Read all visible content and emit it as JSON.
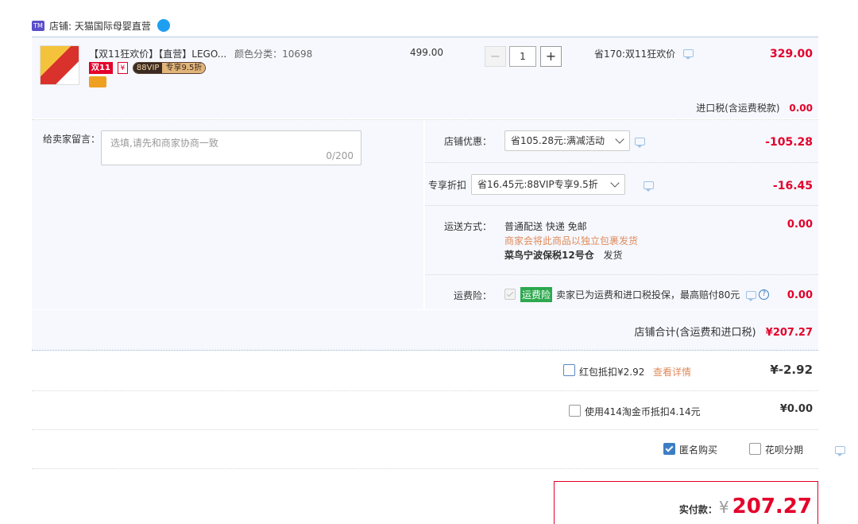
{
  "shop": {
    "icon": "tmall-icon",
    "name": "店铺: 天猫国际母婴直营",
    "badge_icon": "wangwang-icon"
  },
  "item": {
    "title": "【双11狂欢价】【直营】LEGO...",
    "sku": "颜色分类：10698",
    "tag_double11": "双11",
    "tag_yuan": "¥",
    "tag_vip": "88VIP",
    "tag_vip_discount": "专享9.5折",
    "unit_price": "499.00",
    "quantity": "1",
    "minus": "−",
    "plus": "+",
    "promo": "省170:双11狂欢价",
    "subtotal": "329.00",
    "import_tax_label": "进口税(含运费税款)",
    "import_tax_value": "0.00"
  },
  "message": {
    "label": "给卖家留言：",
    "placeholder": "选填,请先和商家协商一致",
    "counter": "0/200"
  },
  "shop_discount": {
    "label": "店铺优惠：",
    "selected": "省105.28元:满减活动",
    "value": "-105.28"
  },
  "vip_discount": {
    "label": "专享折扣",
    "selected": "省16.45元:88VIP专享9.5折",
    "value": "-16.45"
  },
  "shipping": {
    "label": "运送方式：",
    "method": "普通配送 快递 免邮",
    "note": "商家会将此商品以独立包裹发货",
    "warehouse": "菜鸟宁波保税12号仓",
    "ship_text": "发货",
    "value": "0.00"
  },
  "insurance": {
    "label": "运费险：",
    "tag": "运费险",
    "desc": "卖家已为运费和进口税投保，最高赔付80元",
    "value": "0.00",
    "help": "?"
  },
  "shop_total": {
    "label": "店铺合计(含运费和进口税)",
    "value": "¥207.27"
  },
  "red_packet": {
    "label": "红包抵扣¥2.92",
    "link": "查看详情",
    "value": "¥-2.92"
  },
  "coins": {
    "label": "使用414淘金币抵扣4.14元",
    "value": "¥0.00"
  },
  "options": {
    "anonymous": "匿名购买",
    "installment": "花呗分期"
  },
  "pay": {
    "label": "实付款：",
    "currency": "¥",
    "amount": "207.27"
  },
  "colors": {
    "accent": "#e4002b",
    "link": "#3c7ec4",
    "panel": "#f6f8fd",
    "border": "#b8cce4"
  }
}
